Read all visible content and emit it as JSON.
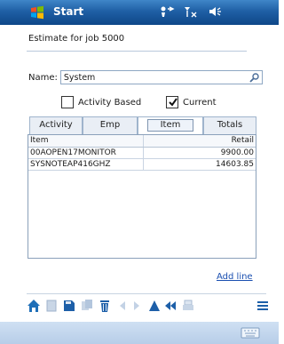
{
  "titlebar": {
    "title": "Start"
  },
  "job": {
    "header": "Estimate for job 5000"
  },
  "form": {
    "name_label": "Name:",
    "name_value": "System",
    "activity_based_label": "Activity Based",
    "activity_based_checked": false,
    "current_label": "Current",
    "current_checked": true
  },
  "tabs": [
    {
      "label": "Activity"
    },
    {
      "label": "Emp"
    },
    {
      "label": "Item",
      "active": true
    },
    {
      "label": "Totals"
    }
  ],
  "grid": {
    "columns": [
      "Item",
      "Retail"
    ],
    "rows": [
      {
        "item": "00AOPEN17MONITOR",
        "retail": "9900.00"
      },
      {
        "item": "SYSNOTEAP416GHZ",
        "retail": "14603.85"
      }
    ]
  },
  "actions": {
    "add_line": "Add line"
  },
  "toolbar_icons": [
    "home-icon",
    "new-doc-icon",
    "save-icon",
    "copy-icon",
    "delete-icon",
    "prev-icon",
    "next-icon",
    "up-icon",
    "back-icon",
    "print-icon",
    "menu-icon"
  ],
  "colors": {
    "title_bar": "#1f5fa5",
    "link": "#1a4fb0",
    "footer": "#c4d7ee"
  }
}
